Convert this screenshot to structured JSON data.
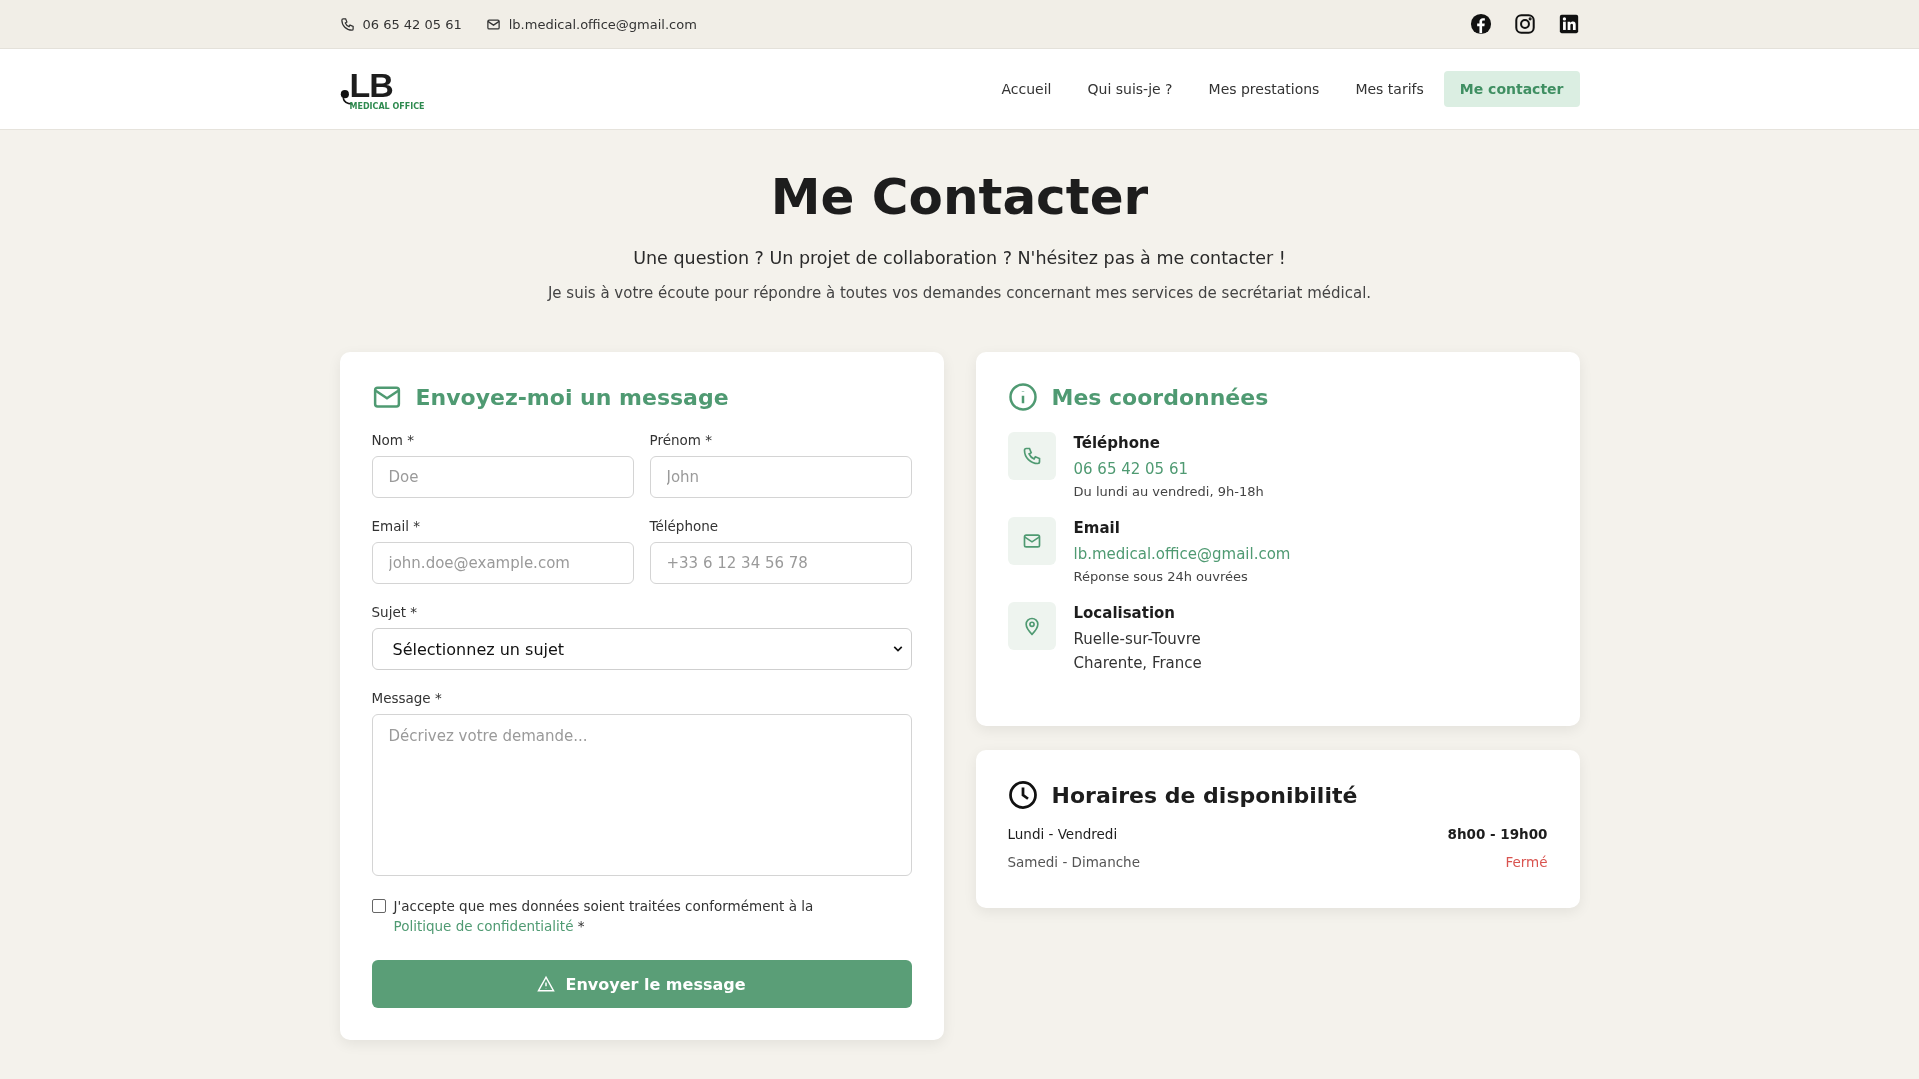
{
  "topbar": {
    "phone": "06 65 42 05 61",
    "email": "lb.medical.office@gmail.com"
  },
  "logo": {
    "letters": "LB",
    "tagline": "MEDICAL OFFICE"
  },
  "nav": [
    {
      "label": "Accueil",
      "selected": false
    },
    {
      "label": "Qui suis-je ?",
      "selected": false
    },
    {
      "label": "Mes prestations",
      "selected": false
    },
    {
      "label": "Mes tarifs",
      "selected": false
    },
    {
      "label": "Me contacter",
      "selected": true
    }
  ],
  "hero": {
    "title": "Me Contacter",
    "subtitle": "Une question ? Un projet de collaboration ? N'hésitez pas à me contacter !",
    "text": "Je suis à votre écoute pour répondre à toutes vos demandes concernant mes services de secrétariat médical."
  },
  "form": {
    "title": "Envoyez-moi un message",
    "fields": [
      {
        "label": "Nom *",
        "placeholder": "Doe"
      },
      {
        "label": "Prénom *",
        "placeholder": "John"
      },
      {
        "label": "Email *",
        "placeholder": "john.doe@example.com"
      },
      {
        "label": "Téléphone",
        "placeholder": "+33 6 12 34 56 78"
      }
    ],
    "subject": {
      "label": "Sujet *",
      "value": "Sélectionnez un sujet"
    },
    "message": {
      "label": "Message *",
      "placeholder": "Décrivez votre demande..."
    },
    "consent": {
      "text": "J'accepte que mes données soient traitées conformément à la",
      "link": "Politique de confidentialité",
      "suffix": "*",
      "checked": false
    },
    "submit": "Envoyer le message"
  },
  "contact": {
    "title": "Mes coordonnées",
    "items": [
      {
        "kind": "phone",
        "title": "Téléphone",
        "lines": [
          "06 65 42 05 61"
        ],
        "note": "Du lundi au vendredi, 9h-18h",
        "link": true
      },
      {
        "kind": "email",
        "title": "Email",
        "lines": [
          "lb.medical.office@gmail.com"
        ],
        "note": "Réponse sous 24h ouvrées",
        "link": true
      },
      {
        "kind": "location",
        "title": "Localisation",
        "lines": [
          "Ruelle-sur-Touvre",
          "Charente, France"
        ],
        "link": false
      }
    ]
  },
  "hours": {
    "title": "Horaires de disponibilité",
    "rows": [
      {
        "days": "Lundi - Vendredi",
        "time": "8h00 - 19h00",
        "closed": false
      },
      {
        "days": "Samedi - Dimanche",
        "time": "Fermé",
        "closed": true
      }
    ]
  }
}
